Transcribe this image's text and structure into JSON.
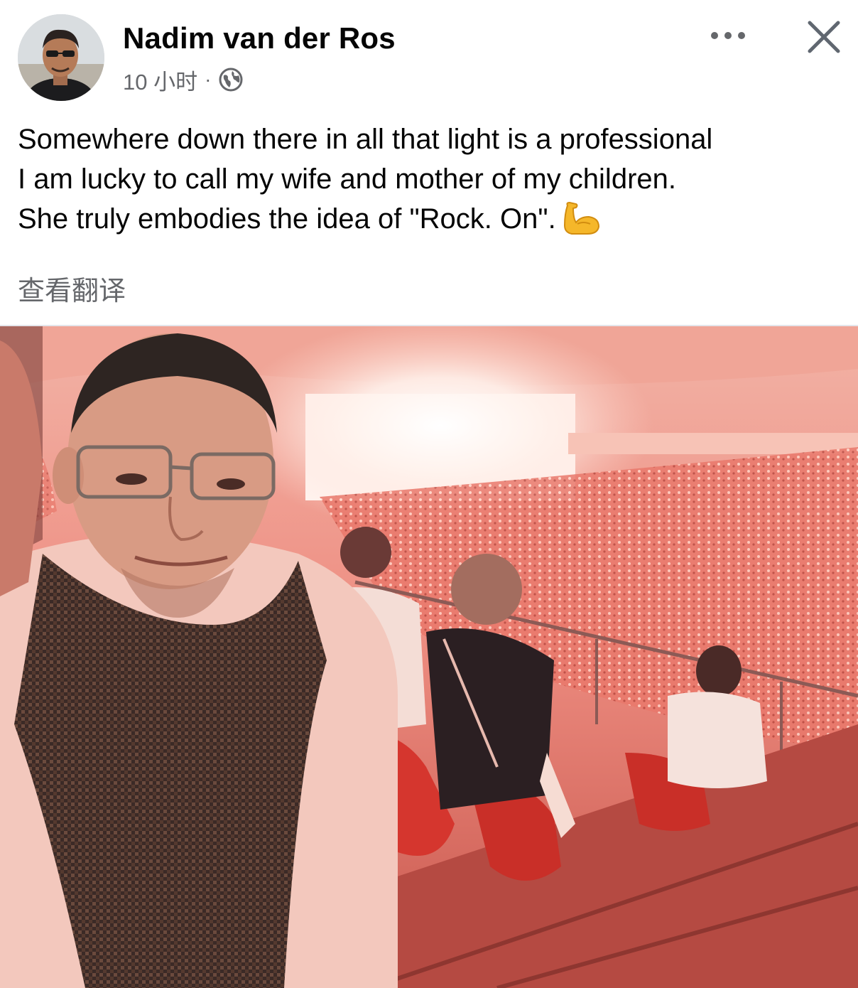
{
  "post": {
    "author_name": "Nadim van der Ros",
    "timestamp": "10 小时",
    "separator": "·",
    "audience_icon": "globe-icon",
    "text_lines": [
      "Somewhere down there in all that light is a professional",
      "I am lucky to call my wife and mother of my children.",
      "She truly embodies the idea of \"Rock. On\"."
    ],
    "emoji": "flexed-biceps-emoji",
    "translate_label": "查看翻译"
  },
  "header_actions": {
    "more_icon": "more-horizontal-icon",
    "close_icon": "close-icon"
  },
  "colors": {
    "text_primary": "#050505",
    "text_secondary": "#65676b",
    "photo_tint": "#e8897f",
    "emoji_yellow": "#f5b72a"
  }
}
